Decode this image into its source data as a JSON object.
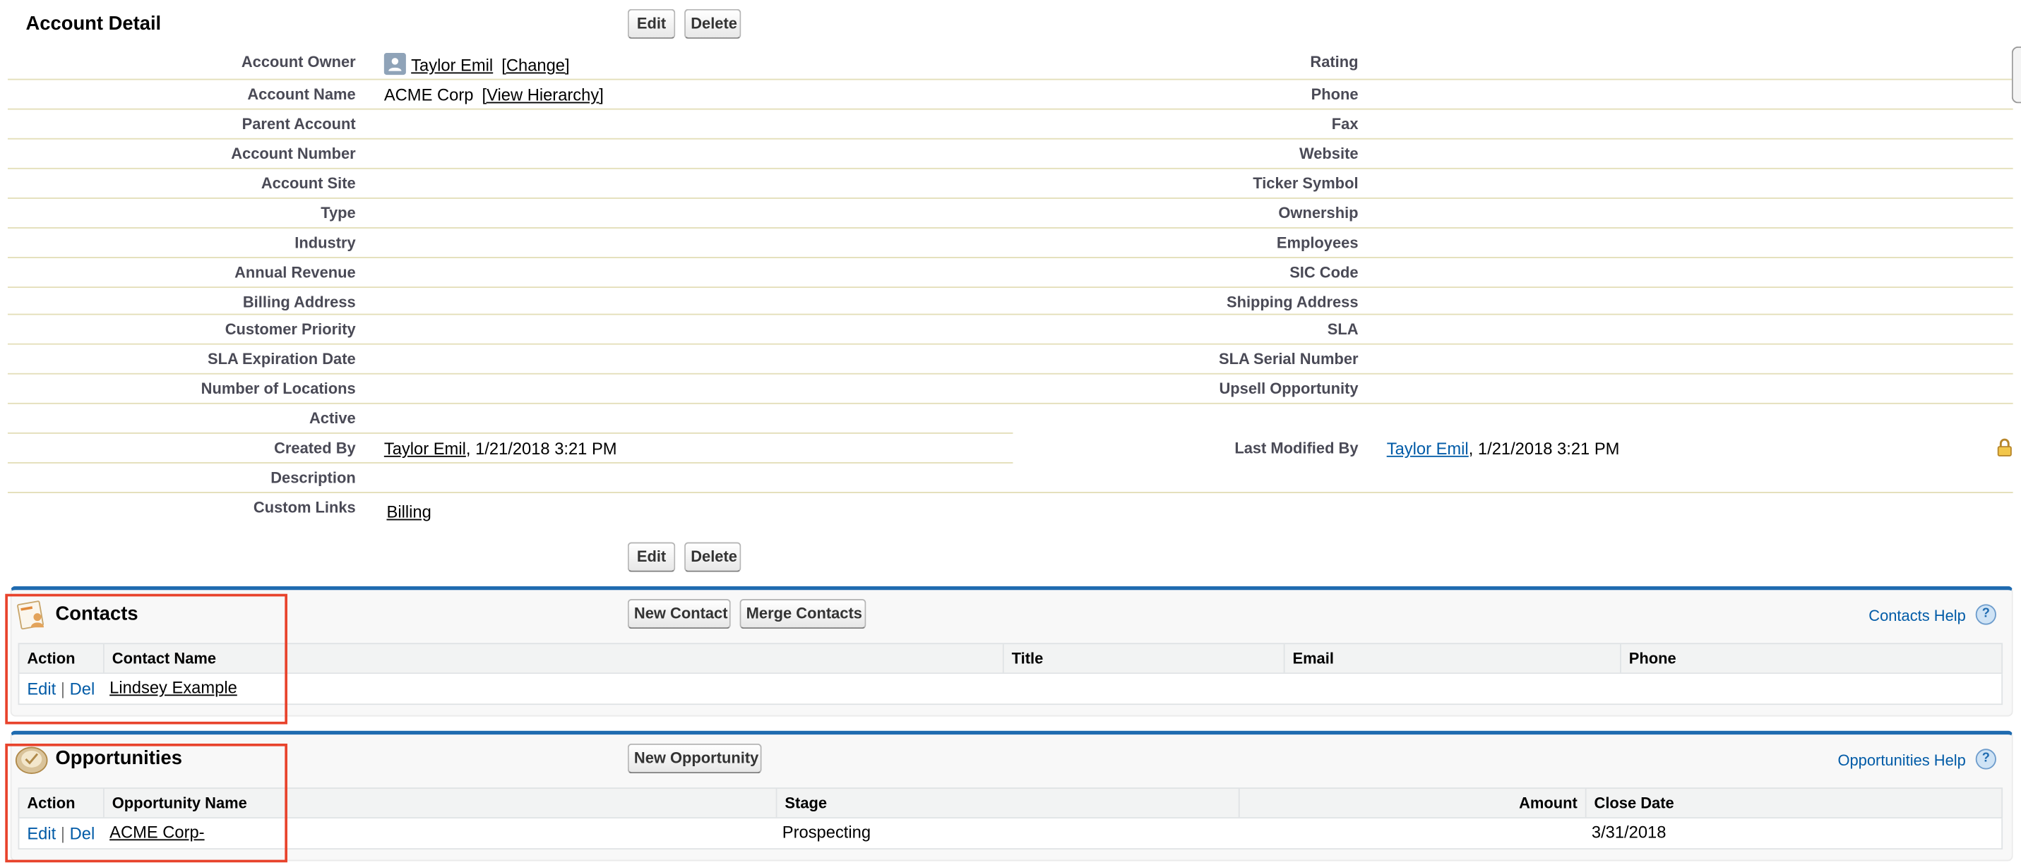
{
  "account_detail": {
    "title": "Account Detail",
    "edit_label": "Edit",
    "delete_label": "Delete",
    "left_fields": [
      {
        "label": "Account Owner"
      },
      {
        "label": "Account Name"
      },
      {
        "label": "Parent Account"
      },
      {
        "label": "Account Number"
      },
      {
        "label": "Account Site"
      },
      {
        "label": "Type"
      },
      {
        "label": "Industry"
      },
      {
        "label": "Annual Revenue"
      },
      {
        "label": "Billing Address"
      },
      {
        "label": "Customer Priority"
      },
      {
        "label": "SLA Expiration Date"
      },
      {
        "label": "Number of Locations"
      },
      {
        "label": "Active"
      },
      {
        "label": "Created By"
      },
      {
        "label": "Description"
      },
      {
        "label": "Custom Links"
      }
    ],
    "right_fields": [
      {
        "label": "Rating"
      },
      {
        "label": "Phone"
      },
      {
        "label": "Fax"
      },
      {
        "label": "Website"
      },
      {
        "label": "Ticker Symbol"
      },
      {
        "label": "Ownership"
      },
      {
        "label": "Employees"
      },
      {
        "label": "SIC Code"
      },
      {
        "label": "Shipping Address"
      },
      {
        "label": "SLA"
      },
      {
        "label": "SLA Serial Number"
      },
      {
        "label": "Upsell Opportunity"
      },
      {
        "label": "Last Modified By"
      }
    ],
    "owner_name": "Taylor Emil",
    "owner_change": "[Change]",
    "account_name": "ACME Corp",
    "view_hierarchy": "[View Hierarchy]",
    "created_by_name": "Taylor Emil",
    "created_by_date": ", 1/21/2018 3:21 PM",
    "modified_by_name": "Taylor Emil",
    "modified_by_date": ", 1/21/2018 3:21 PM",
    "custom_link": "Billing"
  },
  "contacts": {
    "title": "Contacts",
    "new_label": "New Contact",
    "merge_label": "Merge Contacts",
    "help_label": "Contacts Help",
    "columns": [
      "Action",
      "Contact Name",
      "Title",
      "Email",
      "Phone"
    ],
    "rows": [
      {
        "edit": "Edit",
        "sep": "|",
        "del": "Del",
        "name": "Lindsey Example",
        "title": "",
        "email": "",
        "phone": ""
      }
    ]
  },
  "opportunities": {
    "title": "Opportunities",
    "new_label": "New Opportunity",
    "help_label": "Opportunities Help",
    "columns": [
      "Action",
      "Opportunity Name",
      "Stage",
      "Amount",
      "Close Date"
    ],
    "rows": [
      {
        "edit": "Edit",
        "sep": "|",
        "del": "Del",
        "name": "ACME Corp-",
        "stage": "Prospecting",
        "amount": "",
        "close_date": "3/31/2018"
      }
    ]
  },
  "help_glyph": "?",
  "colors": {
    "section_border": "#1f6bb0",
    "highlight": "#e8432c",
    "link_blue": "#015ba7"
  }
}
